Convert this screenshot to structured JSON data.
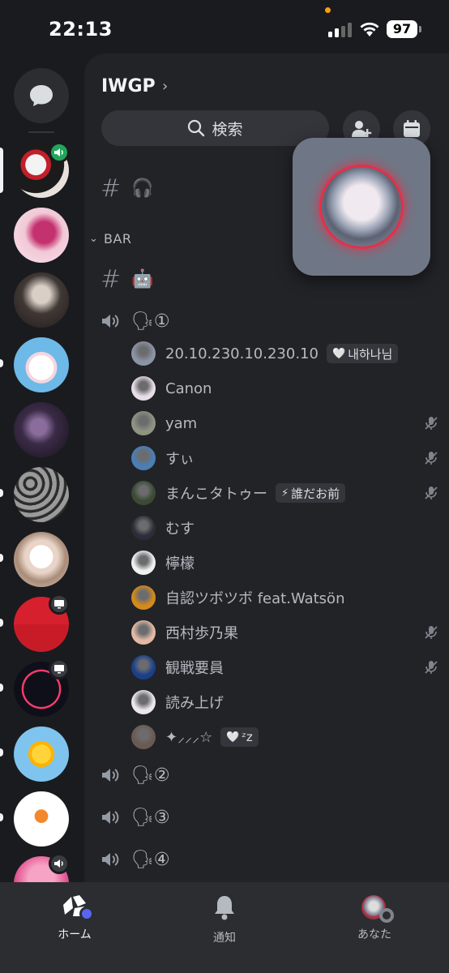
{
  "status_bar": {
    "time": "22:13",
    "battery": "97"
  },
  "server": {
    "name": "IWGP"
  },
  "search": {
    "label": "検索"
  },
  "channels": {
    "top_channel_emoji": "🎧",
    "category": "BAR",
    "bar_channel_emoji": "🤖",
    "voice_channels": [
      {
        "name": "🗣①"
      },
      {
        "name": "🗣②"
      },
      {
        "name": "🗣③"
      },
      {
        "name": "🗣④"
      }
    ]
  },
  "members": [
    {
      "name": "20.10.230.10.230.10",
      "tag": "내하나님",
      "tag_icon": "🤍",
      "muted": false,
      "avatar_color": "#8b93a5"
    },
    {
      "name": "Canon",
      "tag": "",
      "muted": false,
      "avatar_color": "#e8dde8"
    },
    {
      "name": "yam",
      "tag": "",
      "muted": true,
      "avatar_color": "#8d9481"
    },
    {
      "name": "すぃ",
      "tag": "",
      "muted": true,
      "avatar_color": "#4a7fb5"
    },
    {
      "name": "まんこタトゥー",
      "tag": "誰だお前",
      "tag_icon": "⚡",
      "muted": true,
      "avatar_color": "#3b4a33"
    },
    {
      "name": "むす",
      "tag": "",
      "muted": false,
      "avatar_color": "#2b2e38"
    },
    {
      "name": "檸檬",
      "tag": "",
      "muted": false,
      "avatar_color": "#f0f0f0"
    },
    {
      "name": "自認ツボツボ feat.Watsön",
      "tag": "",
      "muted": false,
      "avatar_color": "#d48a1a"
    },
    {
      "name": "西村歩乃果",
      "tag": "",
      "muted": true,
      "avatar_color": "#e3b9a6"
    },
    {
      "name": "観戦要員",
      "tag": "",
      "muted": true,
      "avatar_color": "#1b3f8a"
    },
    {
      "name": "読み上げ",
      "tag": "",
      "muted": false,
      "avatar_color": "#ece6ee"
    },
    {
      "name": "✦⸝⸝⸝☆",
      "tag": "ᶻz",
      "tag_icon": "🤍",
      "muted": false,
      "avatar_color": "#6b5a52"
    }
  ],
  "nav": {
    "home": "ホーム",
    "notifications": "通知",
    "you": "あなた"
  },
  "colors": {
    "accent": "#5865f2",
    "voice_active": "#23a55a"
  }
}
